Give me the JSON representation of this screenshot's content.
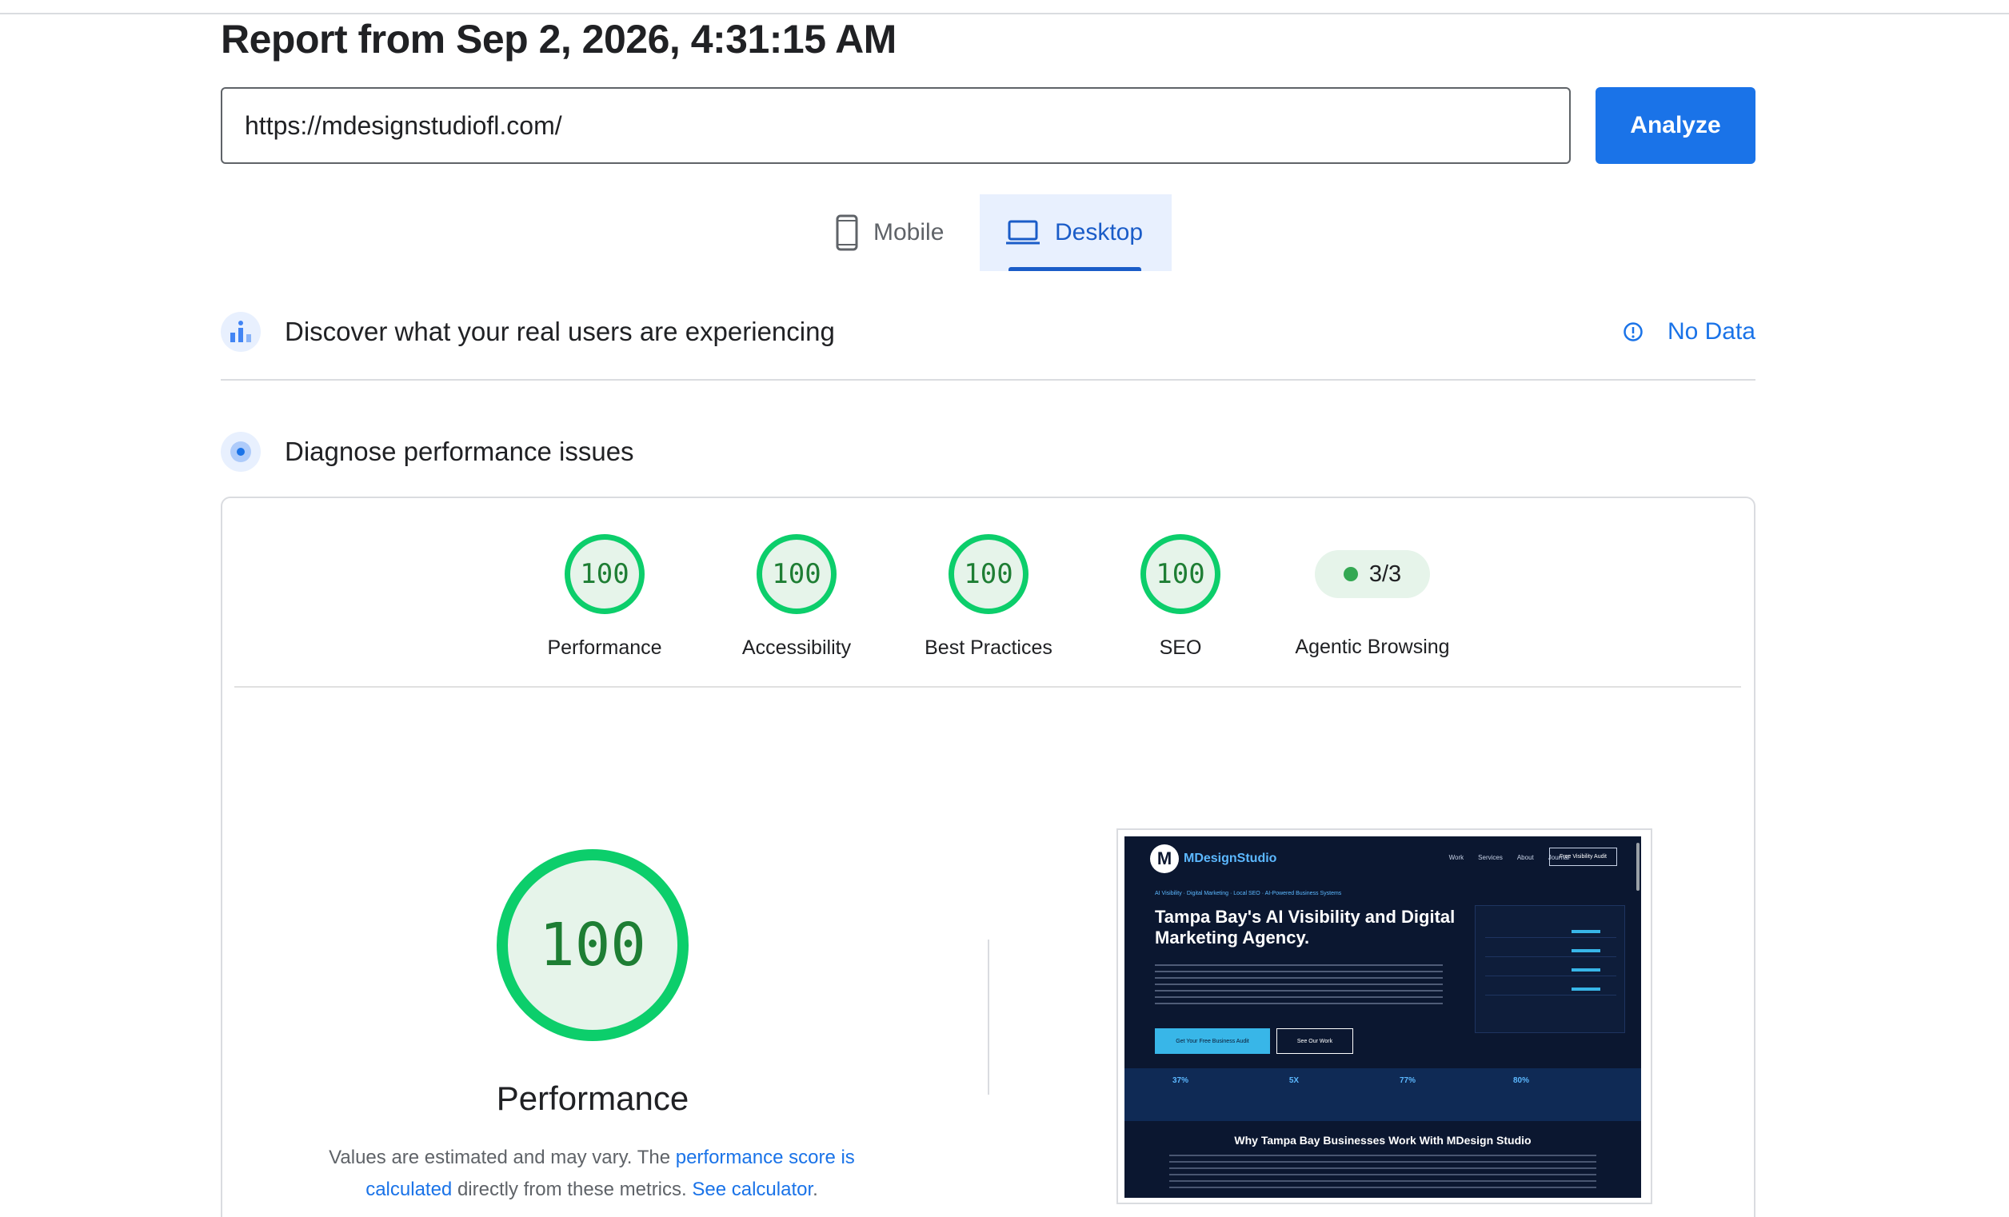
{
  "report": {
    "title": "Report from Sep 2, 2026, 4:31:15 AM"
  },
  "search": {
    "url": "https://mdesignstudiofl.com/",
    "analyze_label": "Analyze"
  },
  "device_tabs": [
    {
      "label": "Mobile",
      "active": false,
      "icon": "phone-icon"
    },
    {
      "label": "Desktop",
      "active": true,
      "icon": "laptop-icon"
    }
  ],
  "field_data": {
    "title": "Discover what your real users are experiencing",
    "status": "No Data"
  },
  "lab_data": {
    "title": "Diagnose performance issues"
  },
  "categories": [
    {
      "label": "Performance",
      "score": "100"
    },
    {
      "label": "Accessibility",
      "score": "100"
    },
    {
      "label": "Best Practices",
      "score": "100"
    },
    {
      "label": "SEO",
      "score": "100"
    }
  ],
  "agentic": {
    "label": "Agentic Browsing",
    "value": "3/3"
  },
  "performance": {
    "score": "100",
    "title": "Performance",
    "note_prefix": "Values are estimated and may vary. The ",
    "note_link": "performance score is calculated",
    "note_mid": " directly from these metrics. ",
    "note_calc": "See calculator",
    "note_end": "."
  },
  "screenshot": {
    "brand": "MDesignStudio",
    "logo_letter": "M",
    "nav_links": [
      "Work",
      "Services",
      "About",
      "Journal"
    ],
    "nav_cta": "Free Visibility Audit",
    "eyebrow": "AI Visibility · Digital Marketing · Local SEO · AI-Powered Business Systems",
    "headline": "Tampa Bay's AI Visibility and Digital Marketing Agency.",
    "cta_primary": "Get Your Free Business Audit",
    "cta_secondary": "See Our Work",
    "stats": [
      "37%",
      "5X",
      "77%",
      "80%"
    ],
    "section_title": "Why Tampa Bay Businesses Work With MDesign Studio"
  },
  "colors": {
    "accent": "#1a73e8",
    "pass": "#0cce6b",
    "pass_bg": "#e6f4ea"
  }
}
